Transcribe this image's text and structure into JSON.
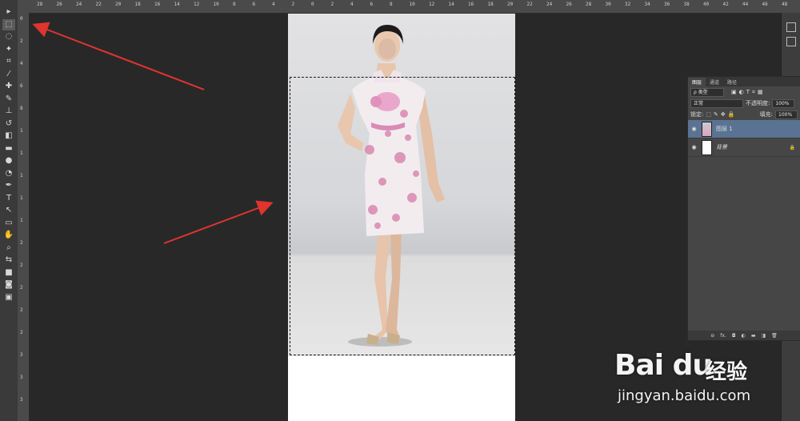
{
  "ruler": {
    "top_ticks": [
      "28",
      "26",
      "24",
      "22",
      "20",
      "18",
      "16",
      "14",
      "12",
      "10",
      "8",
      "6",
      "4",
      "2",
      "0",
      "2",
      "4",
      "6",
      "8",
      "10",
      "12",
      "14",
      "16",
      "18",
      "20",
      "22",
      "24",
      "26",
      "28",
      "30",
      "32",
      "34",
      "36",
      "38",
      "40",
      "42",
      "44",
      "46",
      "48",
      "50"
    ],
    "left_ticks": [
      "0",
      "2",
      "4",
      "6",
      "8",
      "1",
      "1",
      "1",
      "1",
      "1",
      "2",
      "2",
      "2",
      "2",
      "2",
      "3",
      "3",
      "3"
    ]
  },
  "tools": [
    {
      "name": "move-tool",
      "glyph": "▸"
    },
    {
      "name": "marquee-tool",
      "glyph": "⬚",
      "active": true
    },
    {
      "name": "lasso-tool",
      "glyph": "◌"
    },
    {
      "name": "magic-wand-tool",
      "glyph": "✦"
    },
    {
      "name": "crop-tool",
      "glyph": "⌗"
    },
    {
      "name": "eyedropper-tool",
      "glyph": "⁄"
    },
    {
      "name": "healing-brush-tool",
      "glyph": "✚"
    },
    {
      "name": "brush-tool",
      "glyph": "✎"
    },
    {
      "name": "clone-stamp-tool",
      "glyph": "⊥"
    },
    {
      "name": "history-brush-tool",
      "glyph": "↺"
    },
    {
      "name": "eraser-tool",
      "glyph": "◧"
    },
    {
      "name": "gradient-tool",
      "glyph": "▬"
    },
    {
      "name": "blur-tool",
      "glyph": "●"
    },
    {
      "name": "dodge-tool",
      "glyph": "◔"
    },
    {
      "name": "pen-tool",
      "glyph": "✒"
    },
    {
      "name": "type-tool",
      "glyph": "T"
    },
    {
      "name": "path-selection-tool",
      "glyph": "↖"
    },
    {
      "name": "shape-tool",
      "glyph": "▭"
    },
    {
      "name": "hand-tool",
      "glyph": "✋"
    },
    {
      "name": "zoom-tool",
      "glyph": "⌕"
    },
    {
      "name": "swap-colors",
      "glyph": "⇆"
    },
    {
      "name": "color-swatches",
      "glyph": "■"
    },
    {
      "name": "quick-mask",
      "glyph": "◙"
    },
    {
      "name": "screen-mode",
      "glyph": "▣"
    }
  ],
  "layers_panel": {
    "tabs": [
      "图层",
      "通道",
      "路径"
    ],
    "kind_filter": "ρ 类型",
    "blend_mode": "正常",
    "opacity_label": "不透明度:",
    "opacity_value": "100%",
    "lock_label": "锁定:",
    "fill_label": "填充:",
    "fill_value": "100%",
    "layers": [
      {
        "name": "图层 1",
        "selected": true
      },
      {
        "name": "背景",
        "selected": false,
        "locked": true
      }
    ],
    "footer_icons": [
      "link-icon",
      "fx-icon",
      "mask-icon",
      "adjustment-icon",
      "group-icon",
      "new-layer-icon",
      "trash-icon"
    ],
    "footer_glyphs": [
      "⊖",
      "fx.",
      "◘",
      "◐",
      "▬",
      "◨",
      "🗑"
    ]
  },
  "watermark": {
    "logo": "Bai du",
    "cn": "经验",
    "url": "jingyan.baidu.com"
  },
  "colors": {
    "arrow": "#e0342f",
    "selected_layer": "#5a7393"
  }
}
